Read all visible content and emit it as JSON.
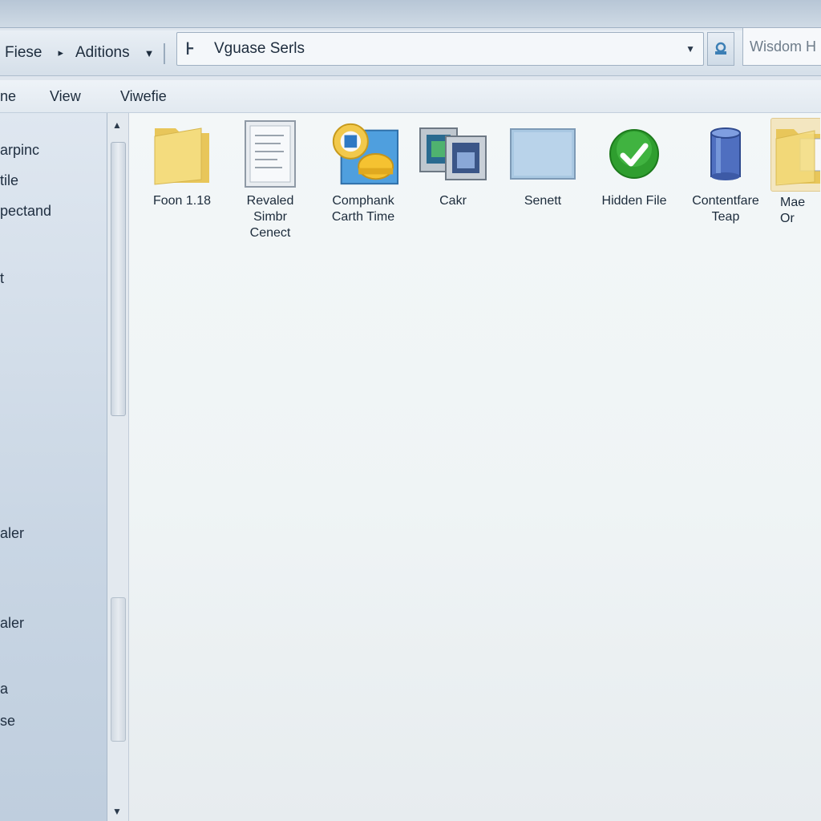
{
  "toolbar": {
    "files_label": "Fiese",
    "actions_label": "Aditions",
    "address_text": "Vguase Serls",
    "search_placeholder": "Wisdom H"
  },
  "menubar": {
    "items": [
      "ne",
      "View",
      "Viwefie"
    ]
  },
  "sidebar": {
    "items": [
      "arpinc",
      "tile",
      "pectand",
      "t",
      "aler",
      "aler",
      "a",
      "se"
    ]
  },
  "files": [
    {
      "label": "Foon 1.18",
      "icon": "folder-icon"
    },
    {
      "label": "Revaled\nSimbr\nCenect",
      "icon": "document-icon"
    },
    {
      "label": "Comphank\nCarth Time",
      "icon": "gear-package-icon"
    },
    {
      "label": "Cakr",
      "icon": "pictures-icon"
    },
    {
      "label": "Senett",
      "icon": "blank-window-icon"
    },
    {
      "label": "Hidden File",
      "icon": "checkmark-icon"
    },
    {
      "label": "Contentfare\nTeap",
      "icon": "database-icon"
    },
    {
      "label": "Mae\nOr",
      "icon": "folder-document-icon"
    }
  ],
  "colors": {
    "accent": "#2f9e2f",
    "folder": "#f0d472",
    "selection": "#f3e6c0"
  }
}
